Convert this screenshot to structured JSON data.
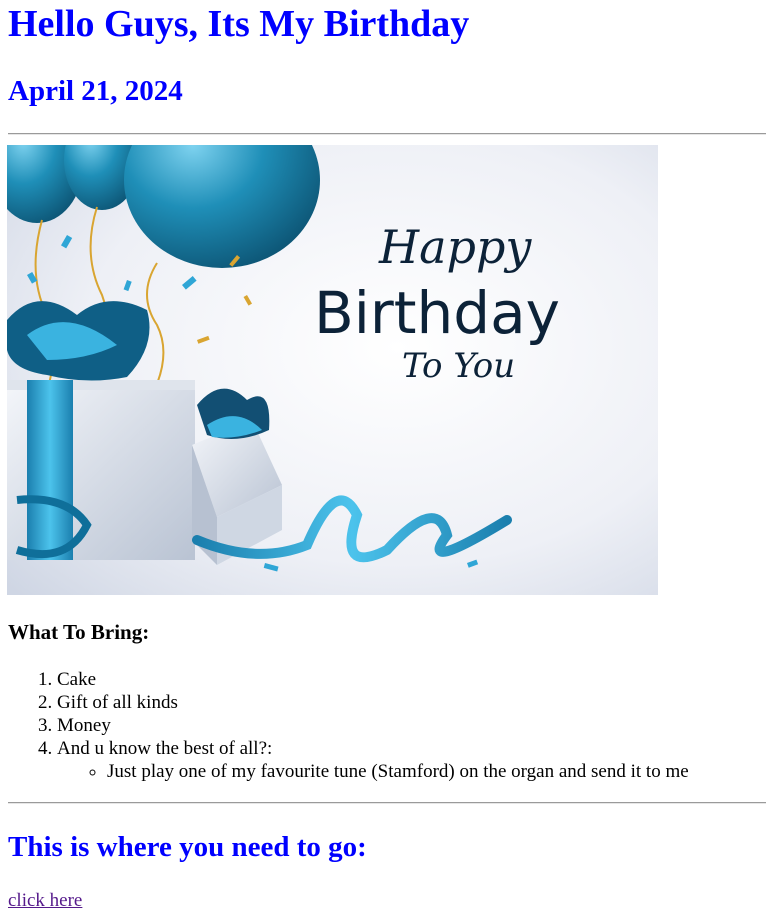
{
  "header": {
    "title": "Hello Guys, Its My Birthday",
    "date": "April 21, 2024"
  },
  "banner": {
    "line1": "Happy",
    "line2": "Birthday",
    "line3": "To You"
  },
  "bring": {
    "heading": "What To Bring:",
    "items": [
      "Cake",
      "Gift of all kinds",
      "Money",
      "And u know the best of all?:"
    ],
    "sub_item": "Just play one of my favourite tune (Stamford) on the organ and send it to me"
  },
  "directions": {
    "heading": "This is where you need to go:",
    "link_label": "click here"
  },
  "colors": {
    "heading": "#0000ff",
    "link_visited": "#551a8b",
    "balloon": "#1f7fa6",
    "ribbon": "#2fa6d6"
  }
}
